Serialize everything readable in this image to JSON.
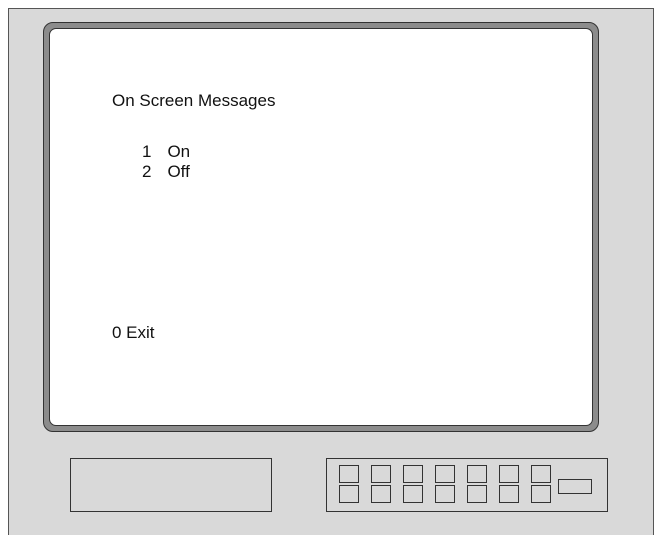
{
  "screen": {
    "title": "On Screen Messages",
    "options": [
      {
        "number": "1",
        "label": "On"
      },
      {
        "number": "2",
        "label": "Off"
      }
    ],
    "exit": "0 Exit"
  },
  "keypad": {
    "rows": 2,
    "columns": 7
  },
  "colors": {
    "monitor_body": "#d9d9d9",
    "bezel": "#8c8c8c",
    "screen": "#ffffff",
    "text": "#111111"
  }
}
